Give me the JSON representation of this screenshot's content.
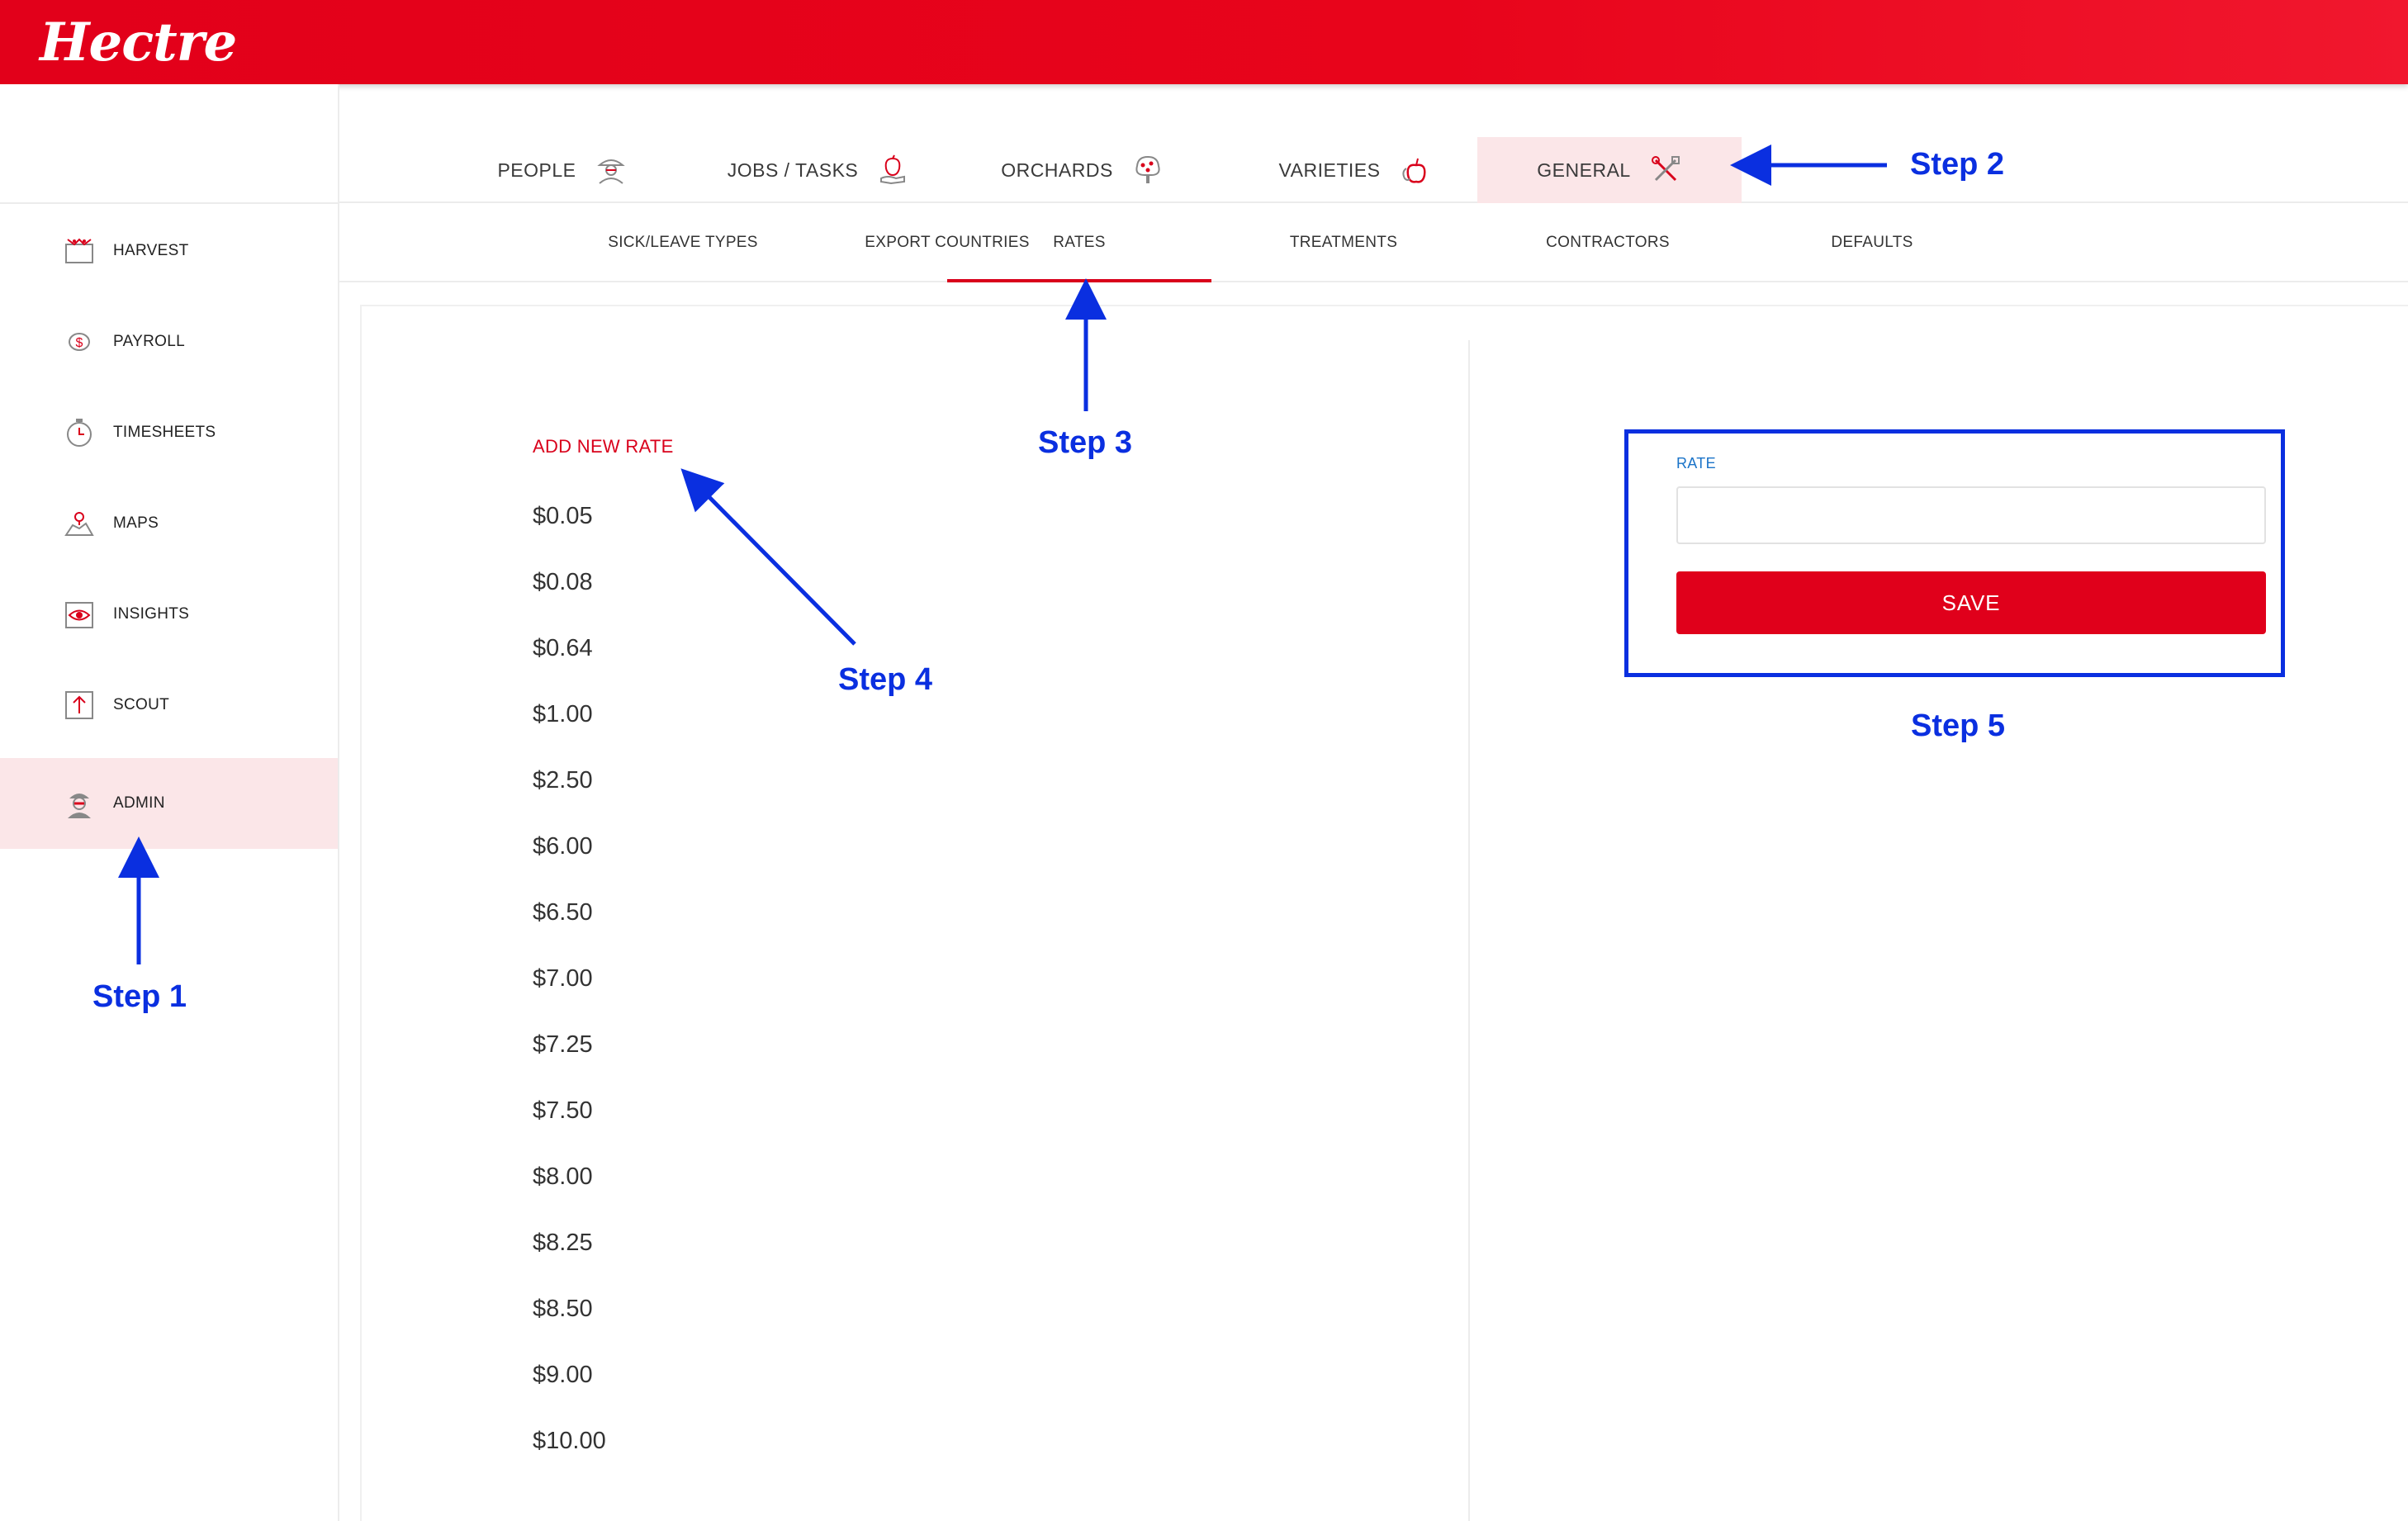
{
  "app": {
    "logo": "Hectre"
  },
  "colors": {
    "brand": "#e2001a",
    "accent_bg": "#fbe6e8",
    "annotation": "#0a2fe0",
    "link": "#1a73c8"
  },
  "sidebar": {
    "items": [
      {
        "label": "HARVEST",
        "icon": "harvest-icon",
        "active": false
      },
      {
        "label": "PAYROLL",
        "icon": "payroll-icon",
        "active": false
      },
      {
        "label": "TIMESHEETS",
        "icon": "timesheets-icon",
        "active": false
      },
      {
        "label": "MAPS",
        "icon": "maps-icon",
        "active": false
      },
      {
        "label": "INSIGHTS",
        "icon": "insights-icon",
        "active": false
      },
      {
        "label": "SCOUT",
        "icon": "scout-icon",
        "active": false
      },
      {
        "label": "ADMIN",
        "icon": "admin-icon",
        "active": true
      }
    ]
  },
  "main_tabs": [
    {
      "label": "PEOPLE",
      "icon": "people-icon",
      "active": false
    },
    {
      "label": "JOBS / TASKS",
      "icon": "jobs-icon",
      "active": false
    },
    {
      "label": "ORCHARDS",
      "icon": "orchards-icon",
      "active": false
    },
    {
      "label": "VARIETIES",
      "icon": "varieties-icon",
      "active": false
    },
    {
      "label": "GENERAL",
      "icon": "tools-icon",
      "active": true
    }
  ],
  "sub_tabs": [
    {
      "label": "SICK/LEAVE TYPES",
      "active": false
    },
    {
      "label": "EXPORT COUNTRIES",
      "active": false
    },
    {
      "label": "RATES",
      "active": true
    },
    {
      "label": "TREATMENTS",
      "active": false
    },
    {
      "label": "CONTRACTORS",
      "active": false
    },
    {
      "label": "DEFAULTS",
      "active": false
    }
  ],
  "rates": {
    "add_label": "ADD NEW RATE",
    "values": [
      "$0.05",
      "$0.08",
      "$0.64",
      "$1.00",
      "$2.50",
      "$6.00",
      "$6.50",
      "$7.00",
      "$7.25",
      "$7.50",
      "$8.00",
      "$8.25",
      "$8.50",
      "$9.00",
      "$10.00"
    ]
  },
  "form": {
    "rate_label": "RATE",
    "rate_value": "",
    "save_label": "SAVE"
  },
  "annotations": {
    "step1": "Step 1",
    "step2": "Step 2",
    "step3": "Step 3",
    "step4": "Step 4",
    "step5": "Step 5"
  }
}
